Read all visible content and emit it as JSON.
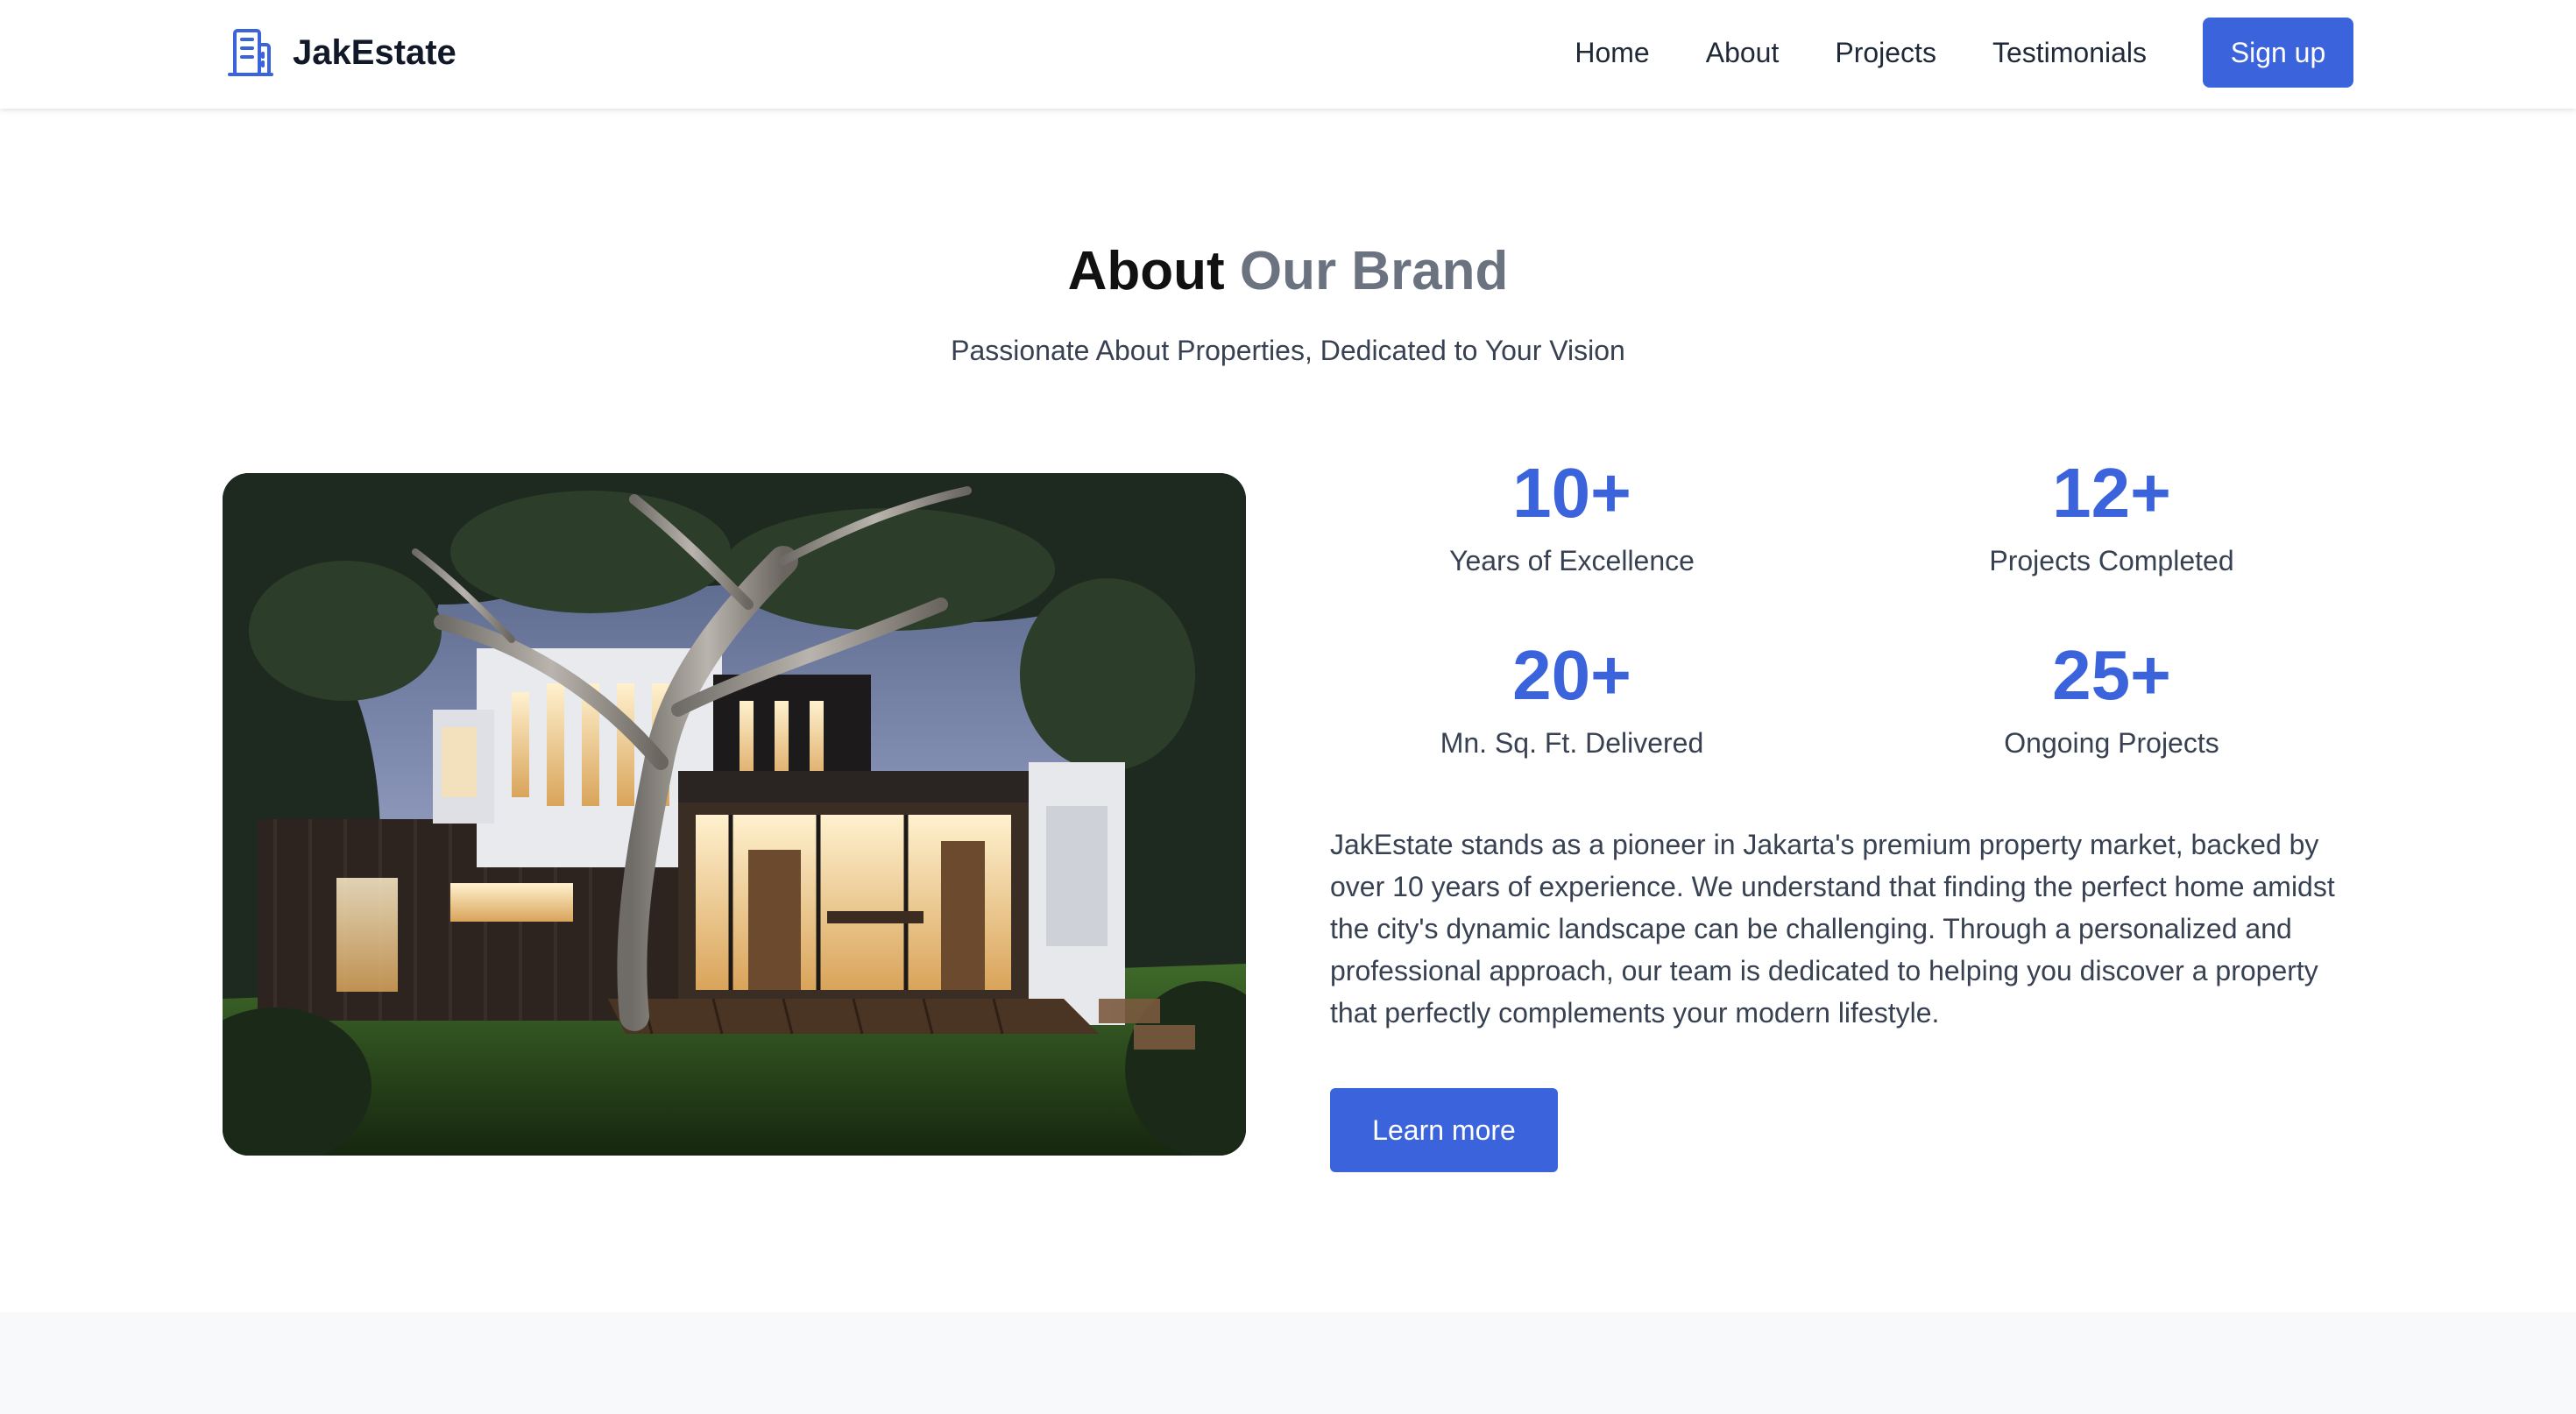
{
  "header": {
    "brand_name": "JakEstate",
    "brand_icon": "building-icon",
    "nav": [
      "Home",
      "About",
      "Projects",
      "Testimonials"
    ],
    "signup_label": "Sign up"
  },
  "about": {
    "title_primary": "About",
    "title_secondary": "Our Brand",
    "subtitle": "Passionate About Properties, Dedicated to Your Vision",
    "stats": [
      {
        "value": "10+",
        "label": "Years of Excellence"
      },
      {
        "value": "12+",
        "label": "Projects Completed"
      },
      {
        "value": "20+",
        "label": "Mn. Sq. Ft. Delivered"
      },
      {
        "value": "25+",
        "label": "Ongoing Projects"
      }
    ],
    "description": "JakEstate stands as a pioneer in Jakarta's premium property market, backed by over 10 years of experience. We understand that finding the perfect home amidst the city's dynamic landscape can be challenging. Through a personalized and professional approach, our team is dedicated to helping you discover a property that perfectly complements your modern lifestyle.",
    "cta_label": "Learn more"
  },
  "colors": {
    "accent": "#3b63dc",
    "title_secondary": "#6b7280",
    "bottom_band": "#f8f9fb"
  }
}
